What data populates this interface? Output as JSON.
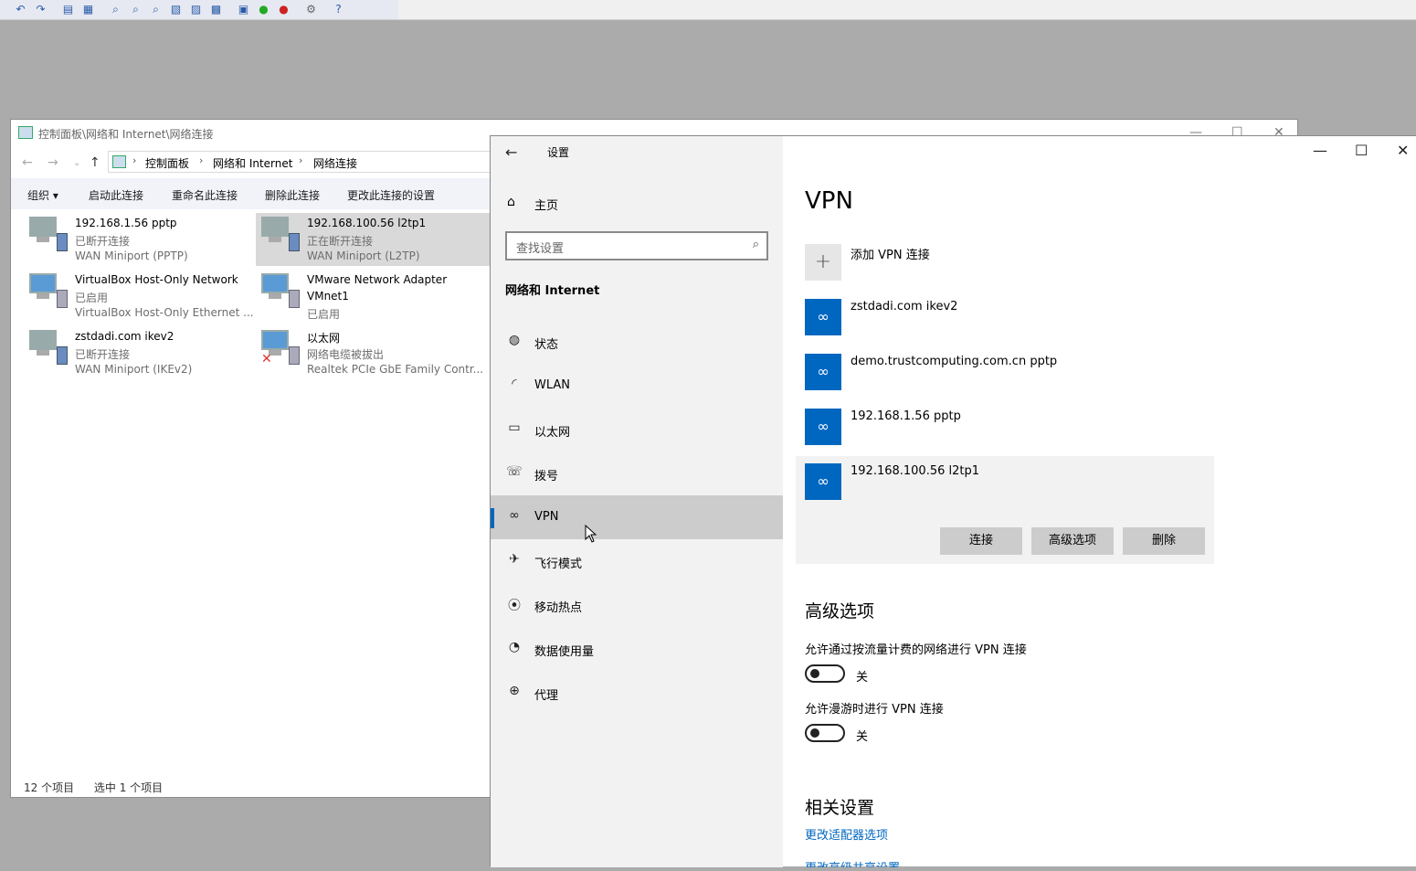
{
  "explorer": {
    "title": "控制面板\\网络和 Internet\\网络连接",
    "breadcrumb": [
      "控制面板",
      "网络和 Internet",
      "网络连接"
    ],
    "commands": [
      "组织 ▾",
      "启动此连接",
      "重命名此连接",
      "删除此连接",
      "更改此连接的设置"
    ],
    "connections": [
      {
        "name": "192.168.1.56 pptp",
        "status": "已断开连接",
        "device": "WAN Miniport (PPTP)"
      },
      {
        "name": "192.168.100.56 l2tp1",
        "status": "正在断开连接",
        "device": "WAN Miniport (L2TP)"
      },
      {
        "name": "VirtualBox Host-Only Network",
        "status": "已启用",
        "device": "VirtualBox Host-Only Ethernet ..."
      },
      {
        "name": "VMware Network Adapter",
        "name2": "VMnet1",
        "status": "已启用"
      },
      {
        "name": "zstdadi.com ikev2",
        "status": "已断开连接",
        "device": "WAN Miniport (IKEv2)"
      },
      {
        "name": "以太网",
        "status": "网络电缆被拔出",
        "device": "Realtek PCIe GbE Family Contr..."
      }
    ],
    "status_count": "12 个项目",
    "status_selected": "选中 1 个项目"
  },
  "settings": {
    "title": "设置",
    "home": "主页",
    "search_placeholder": "查找设置",
    "section": "网络和 Internet",
    "nav": [
      {
        "label": "状态",
        "icon": "globe-status-icon"
      },
      {
        "label": "WLAN",
        "icon": "wifi-icon"
      },
      {
        "label": "以太网",
        "icon": "ethernet-icon"
      },
      {
        "label": "拨号",
        "icon": "dialup-icon"
      },
      {
        "label": "VPN",
        "icon": "vpn-icon"
      },
      {
        "label": "飞行模式",
        "icon": "airplane-icon"
      },
      {
        "label": "移动热点",
        "icon": "hotspot-icon"
      },
      {
        "label": "数据使用量",
        "icon": "data-usage-icon"
      },
      {
        "label": "代理",
        "icon": "globe-icon"
      }
    ],
    "active_nav": "VPN",
    "page_title": "VPN",
    "add_vpn": "添加 VPN 连接",
    "vpns": [
      "zstdadi.com ikev2",
      "demo.trustcomputing.com.cn pptp",
      "192.168.1.56 pptp",
      "192.168.100.56 l2tp1"
    ],
    "buttons": {
      "connect": "连接",
      "advanced": "高级选项",
      "delete": "删除"
    },
    "advanced_title": "高级选项",
    "option1": "允许通过按流量计费的网络进行 VPN 连接",
    "option1_state": "关",
    "option2": "允许漫游时进行 VPN 连接",
    "option2_state": "关",
    "related_title": "相关设置",
    "related_link1": "更改适配器选项",
    "related_link2": "更改高级共享设置"
  },
  "colors": {
    "accent": "#0067c0",
    "sidebar_bg": "#f2f2f2",
    "active_bg": "#cccccc"
  }
}
